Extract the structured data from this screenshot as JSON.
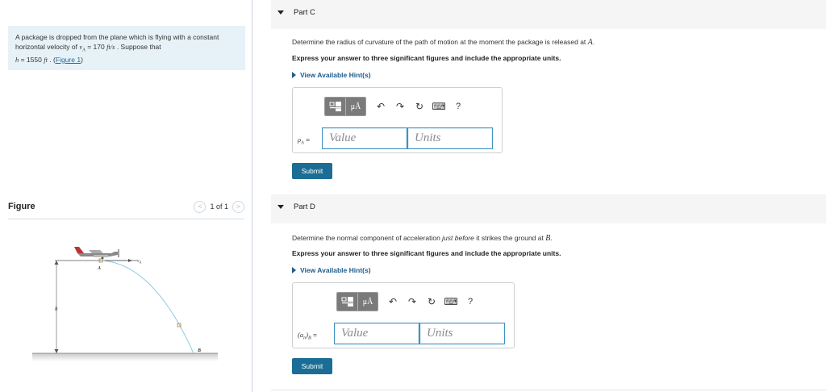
{
  "problem": {
    "text_before": "A package is dropped from the plane which is flying with a constant horizontal velocity of ",
    "v_symbol": "v",
    "v_sub": "A",
    "v_value": " = 170 ",
    "v_unit": "ft/s",
    "text_mid": " . Suppose that",
    "h_symbol": "h",
    "h_value": " = 1550 ",
    "h_unit": "ft",
    "text_after": " . (",
    "figure_link": "Figure 1",
    "close_paren": ")"
  },
  "figure": {
    "title": "Figure",
    "pager": {
      "prev": "<",
      "label": "1 of 1",
      "next": ">"
    },
    "labels": {
      "vA": "v",
      "vA_sub": "A",
      "A": "A",
      "h": "h",
      "B": "B"
    }
  },
  "parts": [
    {
      "title": "Part C",
      "question_before": "Determine the radius of curvature of the path of motion at the moment the package is released at ",
      "question_math": "A",
      "question_after": ".",
      "instruction": "Express your answer to three significant figures and include the appropriate units.",
      "hint": "View Available Hint(s)",
      "answer_symbol": "ρ",
      "answer_sub": "A",
      "answer_eq": " =",
      "value_placeholder": "Value",
      "units_placeholder": "Units",
      "submit": "Submit"
    },
    {
      "title": "Part D",
      "question_before": "Determine the normal component of acceleration ",
      "question_italic": "just before",
      "question_mid": " it strikes the ground at ",
      "question_math": "B",
      "question_after": ".",
      "instruction": "Express your answer to three significant figures and include the appropriate units.",
      "hint": "View Available Hint(s)",
      "answer_symbol": "(a",
      "answer_n": "n",
      "answer_close": ")",
      "answer_sub": "B",
      "answer_eq": " =",
      "value_placeholder": "Value",
      "units_placeholder": "Units",
      "submit": "Submit"
    }
  ],
  "toolbar": {
    "templates_icon": "fraction-template-icon",
    "units_glyph": "μÅ",
    "undo": "↶",
    "redo": "↷",
    "reset": "↻",
    "keyboard": "⌨",
    "help": "?"
  },
  "colors": {
    "accent": "#1b6d96",
    "problem_bg": "#e6f2f7",
    "trajectory": "#8ecae6",
    "field_border": "#3d93c3"
  }
}
